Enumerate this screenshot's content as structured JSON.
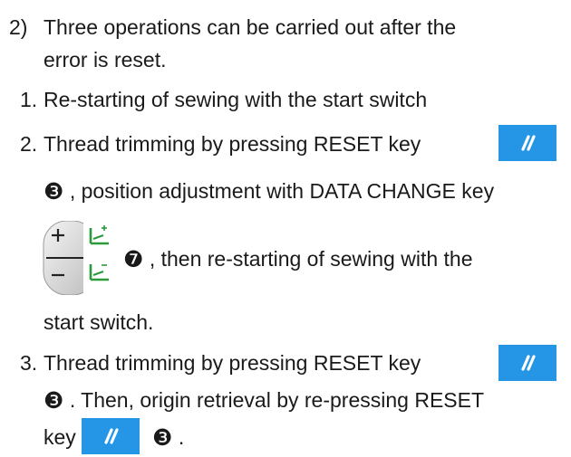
{
  "step_2": {
    "marker": "2)",
    "line_1": "Three operations can be carried out after the",
    "line_2": "error is reset."
  },
  "option_1": {
    "marker": "1.",
    "text": "Re-starting of sewing with the start switch"
  },
  "option_2": {
    "marker": "2.",
    "line_1": "Thread trimming by pressing RESET key",
    "ref_reset": "❸",
    "line_2_text": ", position adjustment with DATA CHANGE key",
    "ref_data_change": "❼",
    "line_3_text": ", then re-starting of sewing with the",
    "line_4": "start switch."
  },
  "option_3": {
    "marker": "3.",
    "line_1": "Thread trimming by pressing RESET key",
    "ref_reset_1": "❸",
    "line_2_text": ". Then, origin retrieval by re-pressing RESET",
    "line_3_text": "key",
    "ref_reset_2": "❸",
    "line_3_end": "."
  },
  "icons": {
    "reset_key": "reset-key-icon",
    "data_change_key": "data-change-key-icon"
  },
  "colors": {
    "reset_key_bg": "#2596e6",
    "text": "#1a1a1a"
  }
}
